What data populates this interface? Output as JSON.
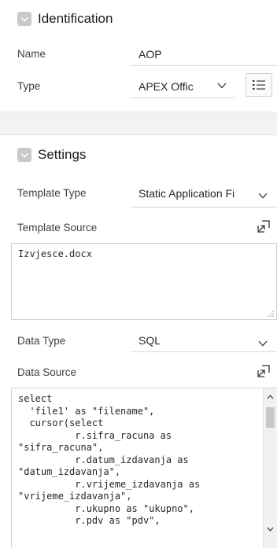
{
  "identification": {
    "title": "Identification",
    "name_label": "Name",
    "name_value": "AOP",
    "type_label": "Type",
    "type_value": "APEX Offic"
  },
  "settings": {
    "title": "Settings",
    "template_type_label": "Template Type",
    "template_type_value": "Static Application Fi",
    "template_source_label": "Template Source",
    "template_source_value": "Izvjesce.docx",
    "data_type_label": "Data Type",
    "data_type_value": "SQL",
    "data_source_label": "Data Source",
    "data_source_value": "select\n  'file1' as \"filename\",\n  cursor(select\n          r.sifra_racuna as\n\"sifra_racuna\",\n          r.datum_izdavanja as\n\"datum_izdavanja\",\n          r.vrijeme_izdavanja as\n\"vrijeme_izdavanja\",\n          r.ukupno as \"ukupno\",\n          r.pdv as \"pdv\","
  },
  "icons": {
    "collapse": "chevron-down-icon",
    "dropdown": "chevron-down-icon",
    "list": "list-icon",
    "expand": "expand-icon",
    "scroll_up": "arrow-up-icon",
    "scroll_down": "arrow-down-icon"
  },
  "colors": {
    "chevron_box": "#c9c9c9",
    "band": "#f2f2f2",
    "border": "#d0d0d0"
  }
}
